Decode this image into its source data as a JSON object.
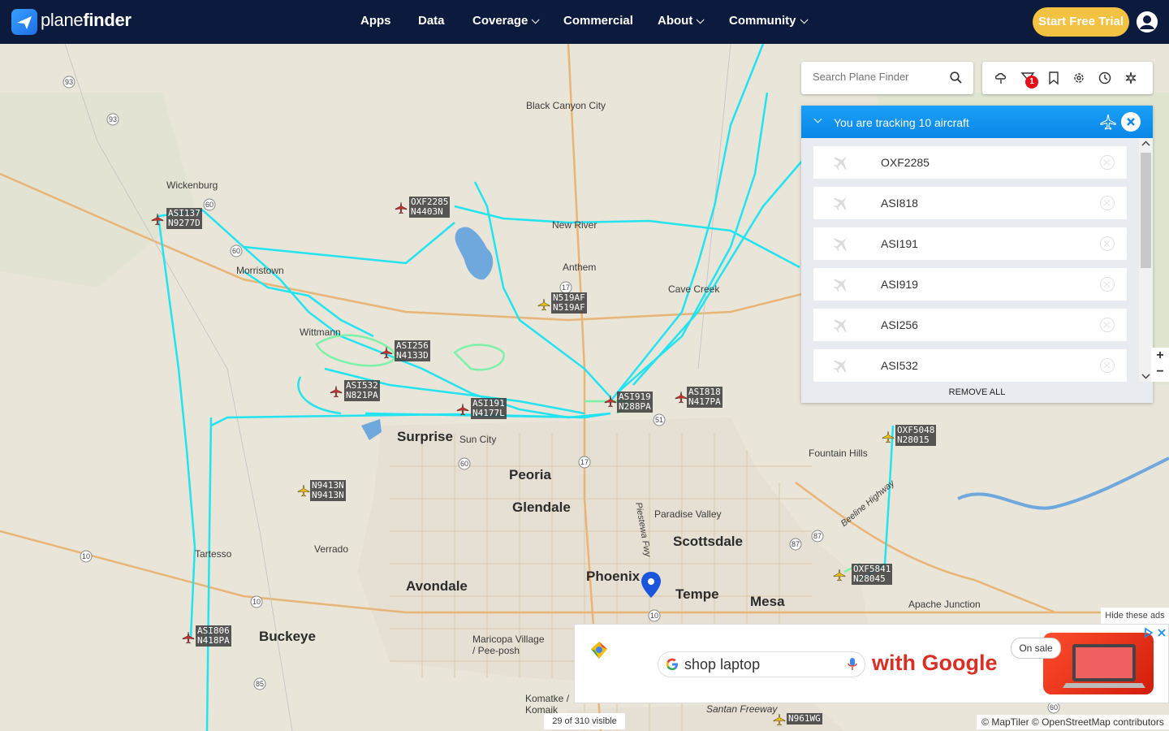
{
  "brand": {
    "name_light": "plane",
    "name_bold": "finder"
  },
  "nav": {
    "items": [
      {
        "label": "Apps",
        "dropdown": false
      },
      {
        "label": "Data",
        "dropdown": false
      },
      {
        "label": "Coverage",
        "dropdown": true
      },
      {
        "label": "Commercial",
        "dropdown": false
      },
      {
        "label": "About",
        "dropdown": true
      },
      {
        "label": "Community",
        "dropdown": true
      }
    ],
    "cta": "Start Free Trial"
  },
  "search": {
    "placeholder": "Search Plane Finder"
  },
  "toolbar": {
    "badge_count": "1"
  },
  "tracking": {
    "title": "You are tracking 10 aircraft",
    "items": [
      "OXF2285",
      "ASI818",
      "ASI191",
      "ASI919",
      "ASI256",
      "ASI532"
    ],
    "remove_all": "REMOVE ALL"
  },
  "places": [
    {
      "name": "Black Canyon City",
      "big": false
    },
    {
      "name": "Wickenburg",
      "big": false
    },
    {
      "name": "New River",
      "big": false
    },
    {
      "name": "Morristown",
      "big": false
    },
    {
      "name": "Anthem",
      "big": false
    },
    {
      "name": "Cave Creek",
      "big": false
    },
    {
      "name": "Wittmann",
      "big": false
    },
    {
      "name": "Surprise",
      "big": true
    },
    {
      "name": "Sun City",
      "big": false
    },
    {
      "name": "Peoria",
      "big": true
    },
    {
      "name": "Fountain Hills",
      "big": false
    },
    {
      "name": "Glendale",
      "big": true
    },
    {
      "name": "Paradise Valley",
      "big": false
    },
    {
      "name": "Scottsdale",
      "big": true
    },
    {
      "name": "Tartesso",
      "big": false
    },
    {
      "name": "Verrado",
      "big": false
    },
    {
      "name": "Phoenix",
      "big": true
    },
    {
      "name": "Avondale",
      "big": true
    },
    {
      "name": "Tempe",
      "big": true
    },
    {
      "name": "Mesa",
      "big": true
    },
    {
      "name": "Apache Junction",
      "big": false
    },
    {
      "name": "Buckeye",
      "big": true
    },
    {
      "name": "Maricopa Village / Pee-posh",
      "big": false
    },
    {
      "name": "Komatke / Komaik",
      "big": false
    },
    {
      "name": "Santan Freeway",
      "big": false
    },
    {
      "name": "Beeline Highway",
      "big": false
    },
    {
      "name": "Piestewa Fwy",
      "big": false
    }
  ],
  "aircraft": [
    {
      "callsign": "OXF2285",
      "reg": "N4403N",
      "color": "#c9302c"
    },
    {
      "callsign": "ASI137",
      "reg": "N9277D",
      "color": "#c9302c"
    },
    {
      "callsign": "N519AF",
      "reg": "N519AF",
      "color": "#f2c200"
    },
    {
      "callsign": "ASI256",
      "reg": "N4133D",
      "color": "#c9302c"
    },
    {
      "callsign": "ASI532",
      "reg": "N821PA",
      "color": "#c9302c"
    },
    {
      "callsign": "ASI191",
      "reg": "N4177L",
      "color": "#c9302c"
    },
    {
      "callsign": "ASI919",
      "reg": "N288PA",
      "color": "#c9302c"
    },
    {
      "callsign": "ASI818",
      "reg": "N417PA",
      "color": "#c9302c"
    },
    {
      "callsign": "OXF5048",
      "reg": "N28015",
      "color": "#f2c200"
    },
    {
      "callsign": "N9413N",
      "reg": "N9413N",
      "color": "#f2c200"
    },
    {
      "callsign": "OXF5841",
      "reg": "N28045",
      "color": "#f2c200"
    },
    {
      "callsign": "ASI806",
      "reg": "N418PA",
      "color": "#c9302c"
    },
    {
      "callsign": "N961WG",
      "reg": "",
      "color": "#f2c200"
    }
  ],
  "ad": {
    "hide_label": "Hide these ads",
    "query": "shop laptop",
    "tagline": "with Google",
    "sale": "On sale"
  },
  "status": {
    "visible": "29 of 310 visible",
    "attribution": "© MapTiler © OpenStreetMap contributors"
  },
  "zoom": {
    "in": "+",
    "out": "−"
  },
  "colors": {
    "nav_bg": "#0c1a3d",
    "cta": "#f4c242",
    "track": "#22e3f0",
    "panel_header": "#1396f2"
  }
}
